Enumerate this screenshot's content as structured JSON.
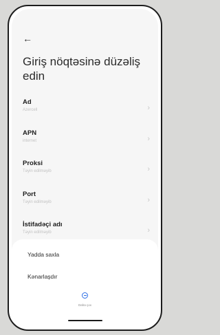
{
  "header": {
    "back_icon": "arrow-left-icon",
    "title": "Giriş nöqtəsinə düzəliş edin"
  },
  "fields": [
    {
      "label": "Ad",
      "value": "Azercell"
    },
    {
      "label": "APN",
      "value": "internet"
    },
    {
      "label": "Proksi",
      "value": "Təyin edilməyib"
    },
    {
      "label": "Port",
      "value": "Təyin edilməyib"
    },
    {
      "label": "İstifadəçi adı",
      "value": "Təyin edilməyib"
    }
  ],
  "sheet": {
    "save_label": "Yadda saxla",
    "discard_label": "Kənarlaşdır",
    "more_label": "Daha çox",
    "more_icon": "minus-circle-icon"
  },
  "colors": {
    "accent": "#2d6ee6",
    "background": "#f6f6f6",
    "sheet": "#ffffff"
  }
}
